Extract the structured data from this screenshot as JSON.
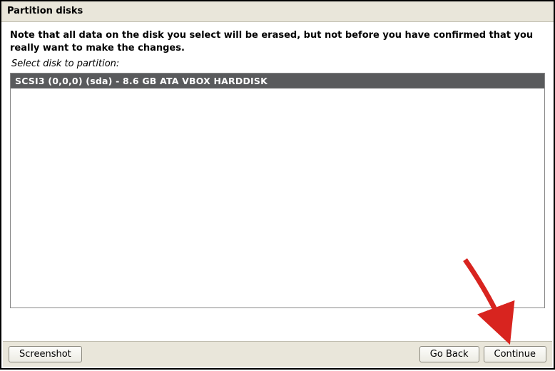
{
  "window": {
    "title": "Partition disks"
  },
  "main": {
    "note": "Note that all data on the disk you select will be erased, but not before you have confirmed that you really want to make the changes.",
    "select_label": "Select disk to partition:",
    "disks": [
      {
        "label": "SCSI3 (0,0,0) (sda) - 8.6 GB ATA VBOX HARDDISK"
      }
    ]
  },
  "footer": {
    "screenshot_label": "Screenshot",
    "go_back_label": "Go Back",
    "continue_label": "Continue"
  }
}
